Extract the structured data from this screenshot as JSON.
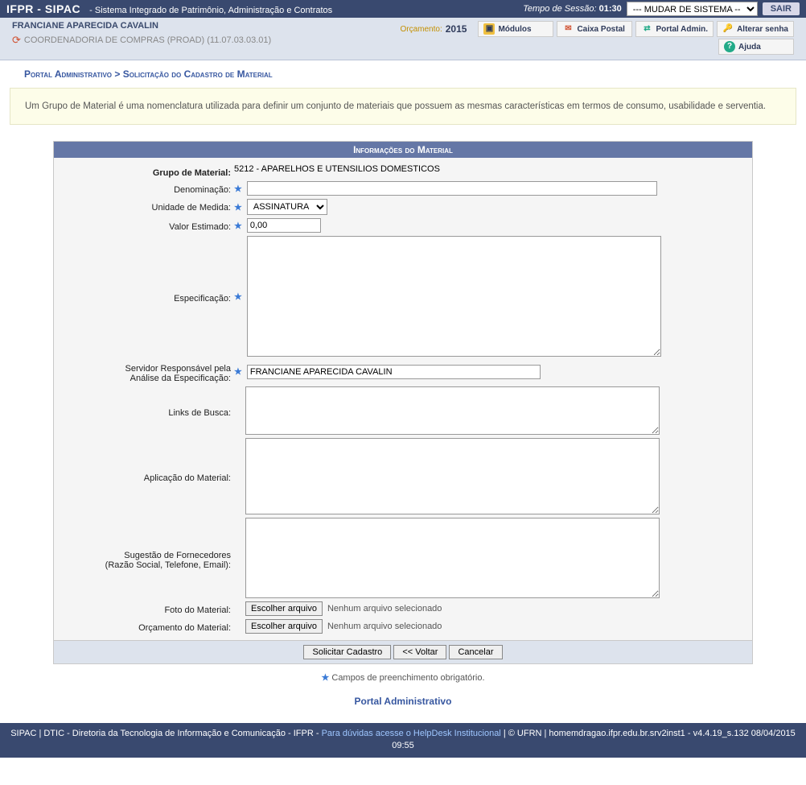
{
  "topbar": {
    "app_abbr": "IFPR - SIPAC",
    "app_title": "- Sistema Integrado de Patrimônio, Administração e Contratos",
    "session_label": "Tempo de Sessão:",
    "session_time": "01:30",
    "system_select": "--- MUDAR DE SISTEMA --",
    "sair": "SAIR"
  },
  "userbar": {
    "user_name": "FRANCIANE APARECIDA CAVALIN",
    "user_dept": "COORDENADORIA DE COMPRAS (PROAD) (11.07.03.03.01)",
    "orc_label": "Orçamento:",
    "orc_year": "2015",
    "btn_modulos": "Módulos",
    "btn_caixa": "Caixa Postal",
    "btn_portal": "Portal Admin.",
    "btn_ajuda": "Ajuda",
    "btn_senha": "Alterar senha"
  },
  "crumb": {
    "a": "Portal Administrativo",
    "sep": ">",
    "b": "Solicitação do Cadastro de Material"
  },
  "info_text": "Um Grupo de Material é uma nomenclatura utilizada para definir um conjunto de materiais que possuem as mesmas características em termos de consumo, usabilidade e serventia.",
  "form": {
    "header": "Informações do Material",
    "label_grupo": "Grupo de Material:",
    "grupo_value": "5212 - APARELHOS E UTENSILIOS DOMESTICOS",
    "label_denom": "Denominação:",
    "denom_value": "",
    "label_unidade": "Unidade de Medida:",
    "unidade_value": "ASSINATURA",
    "label_valor": "Valor Estimado:",
    "valor_value": "0,00",
    "label_espec": "Especificação:",
    "espec_value": "",
    "label_servidor_line1": "Servidor Responsável pela",
    "label_servidor_line2": "Análise da Especificação:",
    "servidor_value": "FRANCIANE APARECIDA CAVALIN",
    "label_links": "Links de Busca:",
    "links_value": "",
    "label_aplic": "Aplicação do Material:",
    "aplic_value": "",
    "label_fornec_line1": "Sugestão de Fornecedores",
    "label_fornec_line2": "(Razão Social, Telefone, Email):",
    "fornec_value": "",
    "label_foto": "Foto do Material:",
    "label_orc": "Orçamento do Material:",
    "file_btn": "Escolher arquivo",
    "file_none": "Nenhum arquivo selecionado",
    "btn_solicitar": "Solicitar Cadastro",
    "btn_voltar": "<< Voltar",
    "btn_cancelar": "Cancelar",
    "hint": "Campos de preenchimento obrigatório."
  },
  "portal_link": "Portal Administrativo",
  "footer": {
    "left": "SIPAC | DTIC - Diretoria da Tecnologia de Informação e Comunicação - IFPR - ",
    "link": "Para dúvidas acesse o HelpDesk Institucional",
    "right": " | © UFRN | homemdragao.ifpr.edu.br.srv2inst1 - v4.4.19_s.132 08/04/2015 09:55"
  }
}
